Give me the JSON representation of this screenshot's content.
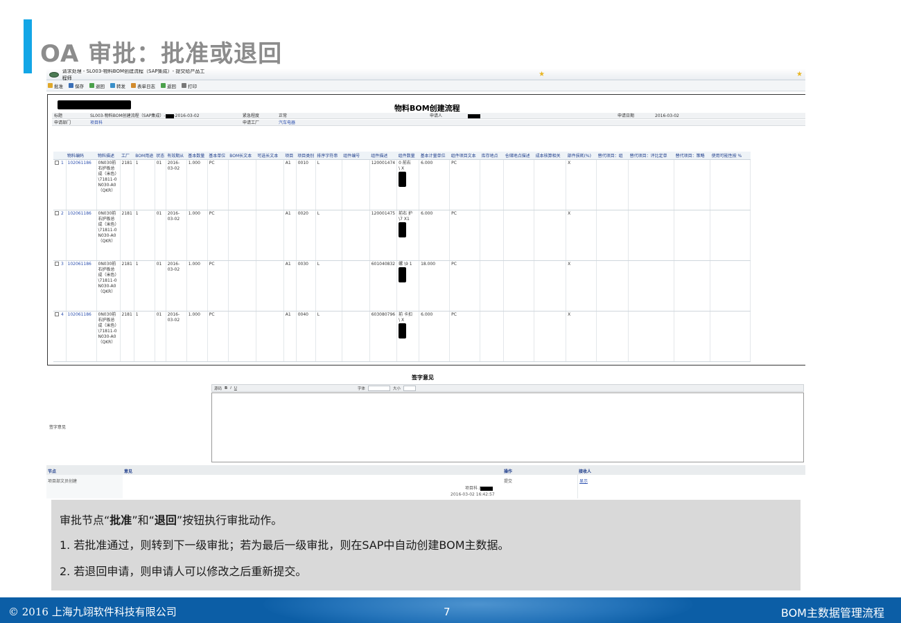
{
  "slide": {
    "title": "OA 审批：批准或退回",
    "footer_copyright": "© 2016 上海九翊软件科技有限公司",
    "page_number": "7",
    "footer_right": "BOM主数据管理流程"
  },
  "window": {
    "title": "请求处理 - SL003-物料BOM创建流程（SAP集成）- 提交给产品工程师",
    "toolbar": [
      "批准",
      "保存",
      "退回",
      "转发",
      "表单日志",
      "返回",
      "打印"
    ]
  },
  "form": {
    "title": "物料BOM创建流程",
    "meta": {
      "subject_label": "标题",
      "subject_value": "SL003-物料BOM创建流程（SAP集成）-",
      "subject_date": "-2016-03-02",
      "urgency_label": "紧急程度",
      "urgency_value": "正常",
      "applicant_label": "申请人",
      "apply_date_label": "申请日期",
      "apply_date_value": "2016-03-02",
      "dept_label": "申请部门",
      "dept_value": "项目科",
      "factory_label": "申请工厂",
      "factory_value": "汽车电器"
    },
    "columns": [
      "物料编码",
      "物料描述",
      "工厂",
      "BOM用途",
      "状态",
      "有效期从",
      "基本数量",
      "基本单位",
      "BOM长文本",
      "可选长文本",
      "项目",
      "项目类别",
      "排序字符串",
      "组件编号",
      "组件描述",
      "组件数量",
      "基本计量单位",
      "组件项目文本",
      "库存地点",
      "仓储地点描述",
      "成本核算相关",
      "部件损耗(%)",
      "替代项目：组",
      "替代项目：评比定单",
      "替代项目：策略",
      "使用可能性按 %"
    ],
    "rows": [
      {
        "idx": "1",
        "material": "102061186",
        "desc": "0N030前右护板总成（米色）\\71811-0N030-A0（QKR）",
        "plant": "2181",
        "usage": "1",
        "status": "01",
        "valid_from": "2016-03-02",
        "qty": "1.000",
        "unit": "PC",
        "alt": "A1",
        "item": "0010",
        "cat": "L",
        "comp_no": "120001474",
        "comp_desc": "0  前右  \\  X",
        "comp_qty": "6.000",
        "comp_unit": "PC",
        "cost": "X"
      },
      {
        "idx": "2",
        "material": "102061186",
        "desc": "0N030前右护板总成（米色）\\71811-0N030-A0（QKR）",
        "plant": "2181",
        "usage": "1",
        "status": "01",
        "valid_from": "2016-03-02",
        "qty": "1.000",
        "unit": "PC",
        "alt": "A1",
        "item": "0020",
        "cat": "L",
        "comp_no": "120001475",
        "comp_desc": "前右  护  \\7  X1",
        "comp_qty": "6.000",
        "comp_unit": "PC",
        "cost": "X"
      },
      {
        "idx": "3",
        "material": "102061186",
        "desc": "0N030前右护板总成（米色）\\71811-0N030-A0（QKR）",
        "plant": "2181",
        "usage": "1",
        "status": "01",
        "valid_from": "2016-03-02",
        "qty": "1.000",
        "unit": "PC",
        "alt": "A1",
        "item": "0030",
        "cat": "L",
        "comp_no": "601040832",
        "comp_desc": "螺  \\9  1",
        "comp_qty": "18.000",
        "comp_unit": "PC",
        "cost": "X"
      },
      {
        "idx": "4",
        "material": "102061186",
        "desc": "0N030前右护板总成（米色）\\71811-0N030-A0（QKR）",
        "plant": "2181",
        "usage": "1",
        "status": "01",
        "valid_from": "2016-03-02",
        "qty": "1.000",
        "unit": "PC",
        "alt": "A1",
        "item": "0040",
        "cat": "L",
        "comp_no": "603080796",
        "comp_desc": "前  卡扣  \\  X",
        "comp_qty": "6.000",
        "comp_unit": "PC",
        "cost": "X"
      }
    ]
  },
  "signature": {
    "title": "签字意见",
    "label": "签字意见",
    "editor_tools": [
      "源码",
      "B",
      "I",
      "U",
      "字体",
      "大小"
    ]
  },
  "log": {
    "headers": {
      "node": "节点",
      "opinion": "意见",
      "action": "操作",
      "receiver": "接收人"
    },
    "row": {
      "node": "项目部文员创建",
      "action": "提交",
      "receiver": "显示",
      "signer": "项目科 /",
      "datetime": "2016-03-02  16:42:57"
    }
  },
  "caption": {
    "line1_pre": "审批节点“",
    "line1_approve": "批准",
    "line1_mid": "”和“",
    "line1_return": "退回",
    "line1_post": "”按钮执行审批动作。",
    "line2": "1.   若批准通过，则转到下一级审批；若为最后一级审批，则在SAP中自动创建BOM主数据。",
    "line3": "2.   若退回申请，则申请人可以修改之后重新提交。"
  },
  "colors": {
    "accent": "#13a6e6",
    "footer": "#0c5ea6",
    "caption_bg": "#d9d9d9",
    "title": "#8c8c8c"
  }
}
